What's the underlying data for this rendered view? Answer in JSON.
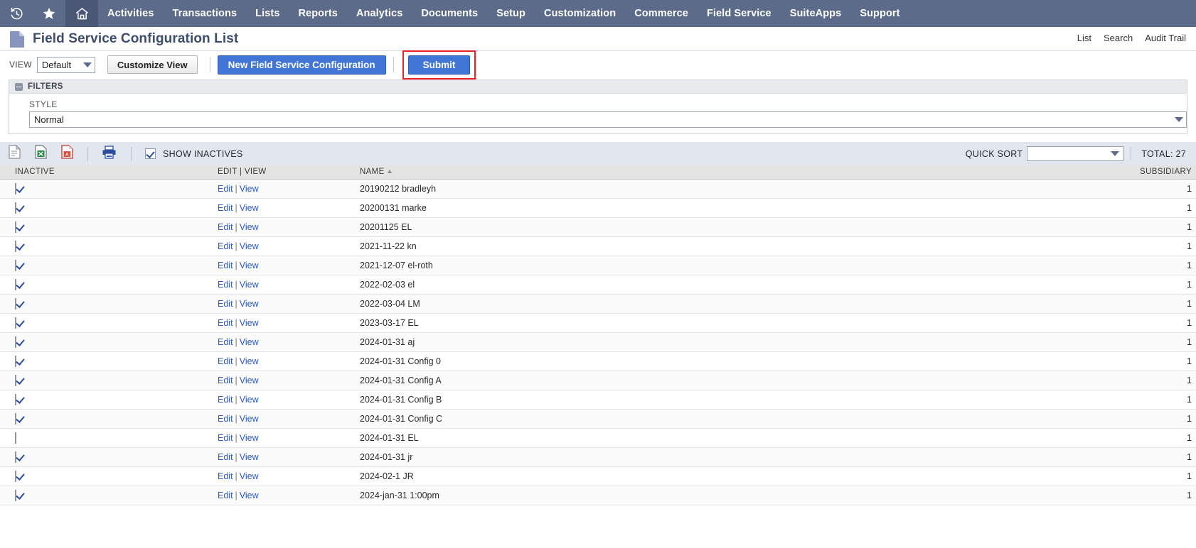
{
  "topnav": {
    "icons": [
      {
        "name": "recent-history-icon",
        "glyph": "history"
      },
      {
        "name": "favorites-icon",
        "glyph": "star"
      },
      {
        "name": "home-icon",
        "glyph": "home"
      }
    ],
    "items": [
      {
        "label": "Activities"
      },
      {
        "label": "Transactions"
      },
      {
        "label": "Lists"
      },
      {
        "label": "Reports"
      },
      {
        "label": "Analytics"
      },
      {
        "label": "Documents"
      },
      {
        "label": "Setup"
      },
      {
        "label": "Customization"
      },
      {
        "label": "Commerce"
      },
      {
        "label": "Field Service"
      },
      {
        "label": "SuiteApps"
      },
      {
        "label": "Support"
      }
    ],
    "background_color": "#5c6b8a",
    "active_background_color": "#4a5875"
  },
  "titlebar": {
    "title": "Field Service Configuration List",
    "links": [
      {
        "label": "List"
      },
      {
        "label": "Search"
      },
      {
        "label": "Audit Trail"
      }
    ]
  },
  "toolbar": {
    "view_label": "VIEW",
    "view_value": "Default",
    "customize_view_label": "Customize View",
    "new_record_label": "New Field Service Configuration",
    "submit_label": "Submit",
    "submit_highlight_color": "#ee2222",
    "primary_button_color": "#4175d6"
  },
  "filters": {
    "title": "FILTERS",
    "style_label": "STYLE",
    "style_value": "Normal"
  },
  "exportbar": {
    "icons": [
      {
        "name": "export-csv-icon"
      },
      {
        "name": "export-excel-icon"
      },
      {
        "name": "export-pdf-icon"
      },
      {
        "name": "print-icon"
      }
    ],
    "show_inactives_label": "SHOW INACTIVES",
    "show_inactives_checked": true,
    "quick_sort_label": "QUICK SORT",
    "quick_sort_value": "",
    "total_label": "TOTAL: 27"
  },
  "table": {
    "columns": [
      {
        "key": "inactive",
        "label": "INACTIVE",
        "align": "left"
      },
      {
        "key": "editview",
        "label": "EDIT | VIEW",
        "align": "left"
      },
      {
        "key": "name",
        "label": "NAME",
        "align": "left",
        "sorted": "asc"
      },
      {
        "key": "subsidiary",
        "label": "SUBSIDIARY",
        "align": "right"
      }
    ],
    "edit_label": "Edit",
    "view_label": "View",
    "rows": [
      {
        "inactive": true,
        "name": "20190212 bradleyh",
        "subsidiary": "1"
      },
      {
        "inactive": true,
        "name": "20200131 marke",
        "subsidiary": "1"
      },
      {
        "inactive": true,
        "name": "20201125 EL",
        "subsidiary": "1"
      },
      {
        "inactive": true,
        "name": "2021-11-22 kn",
        "subsidiary": "1"
      },
      {
        "inactive": true,
        "name": "2021-12-07 el-roth",
        "subsidiary": "1"
      },
      {
        "inactive": true,
        "name": "2022-02-03 el",
        "subsidiary": "1"
      },
      {
        "inactive": true,
        "name": "2022-03-04 LM",
        "subsidiary": "1"
      },
      {
        "inactive": true,
        "name": "2023-03-17 EL",
        "subsidiary": "1"
      },
      {
        "inactive": true,
        "name": "2024-01-31 aj",
        "subsidiary": "1"
      },
      {
        "inactive": true,
        "name": "2024-01-31 Config 0",
        "subsidiary": "1"
      },
      {
        "inactive": true,
        "name": "2024-01-31 Config A",
        "subsidiary": "1"
      },
      {
        "inactive": true,
        "name": "2024-01-31 Config B",
        "subsidiary": "1"
      },
      {
        "inactive": true,
        "name": "2024-01-31 Config C",
        "subsidiary": "1"
      },
      {
        "inactive": false,
        "name": "2024-01-31 EL",
        "subsidiary": "1"
      },
      {
        "inactive": true,
        "name": "2024-01-31 jr",
        "subsidiary": "1"
      },
      {
        "inactive": true,
        "name": "2024-02-1 JR",
        "subsidiary": "1"
      },
      {
        "inactive": true,
        "name": "2024-jan-31 1:00pm",
        "subsidiary": "1"
      }
    ]
  }
}
